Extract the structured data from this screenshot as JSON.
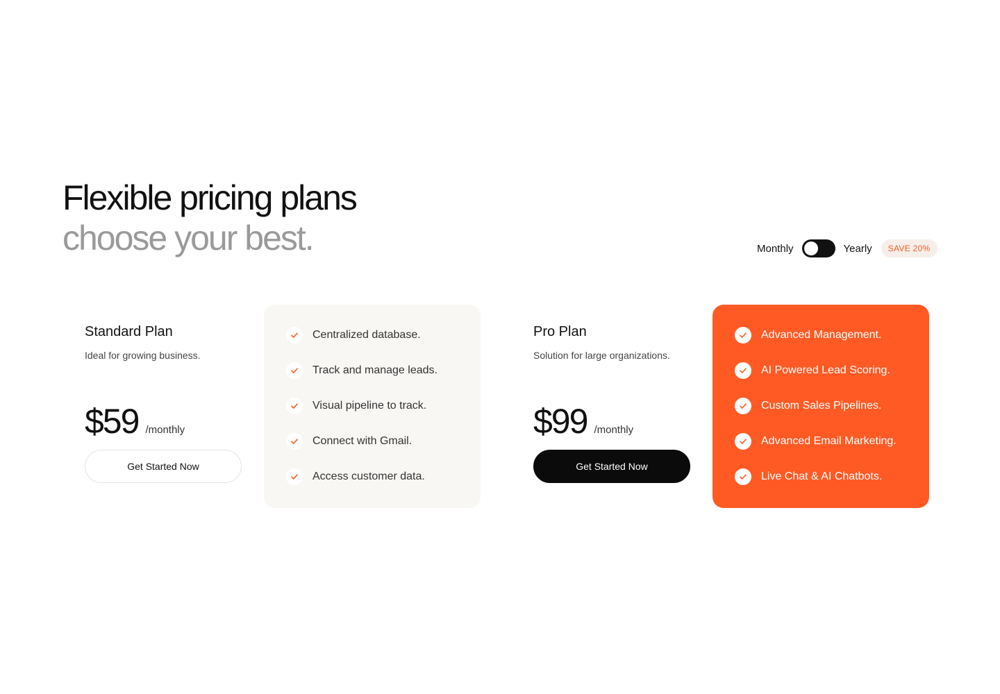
{
  "heading": {
    "line1": "Flexible pricing plans",
    "line2": "choose your best."
  },
  "billing": {
    "monthly_label": "Monthly",
    "yearly_label": "Yearly",
    "save_badge": "SAVE 20%"
  },
  "plans": [
    {
      "name": "Standard Plan",
      "description": "Ideal for growing business.",
      "price": "$59",
      "period": "/monthly",
      "cta": "Get Started Now",
      "features": [
        "Centralized database.",
        "Track and manage leads.",
        "Visual pipeline to track.",
        "Connect with Gmail.",
        "Access customer data."
      ]
    },
    {
      "name": "Pro Plan",
      "description": "Solution for large organizations.",
      "price": "$99",
      "period": "/monthly",
      "cta": "Get Started Now",
      "features": [
        "Advanced Management.",
        "AI Powered Lead Scoring.",
        "Custom Sales Pipelines.",
        "Advanced Email Marketing.",
        "Live Chat & AI Chatbots."
      ]
    }
  ],
  "colors": {
    "accent": "#ff5a24",
    "dark": "#0b0b0b",
    "muted_heading": "#9a9a9a",
    "card_light": "#f8f7f4"
  },
  "icons": {
    "feature_icon": "check-icon"
  }
}
